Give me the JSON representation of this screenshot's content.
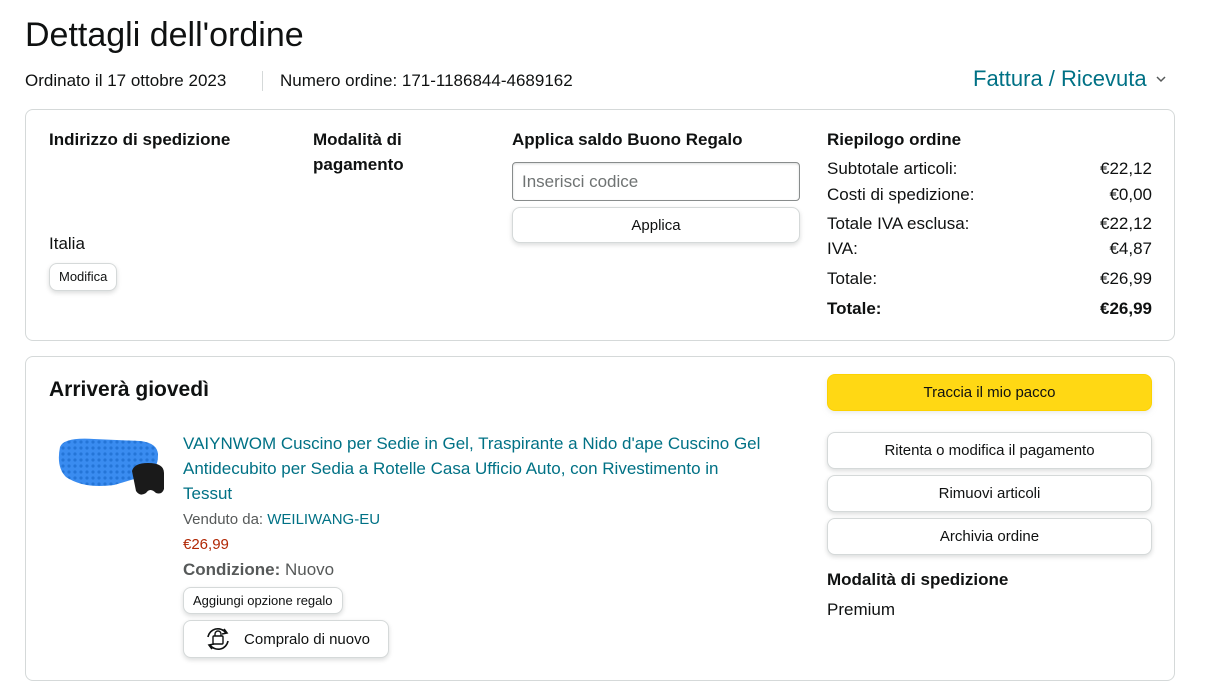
{
  "page": {
    "title": "Dettagli dell'ordine",
    "ordered_on": "Ordinato il 17 ottobre 2023",
    "order_number": "Numero ordine: 171-1186844-4689162",
    "invoice_link": "Fattura / Ricevuta"
  },
  "shipping": {
    "heading": "Indirizzo di spedizione",
    "country": "Italia",
    "edit_button": "Modifica"
  },
  "payment": {
    "heading_line1": "Modalità di",
    "heading_line2": "pagamento"
  },
  "gift_card": {
    "heading": "Applica saldo Buono Regalo",
    "input_placeholder": "Inserisci codice",
    "apply_button": "Applica"
  },
  "summary": {
    "heading": "Riepilogo ordine",
    "rows": [
      {
        "label": "Subtotale articoli:",
        "value": "€22,12"
      },
      {
        "label": "Costi di spedizione:",
        "value": "€0,00"
      },
      {
        "label": "Totale IVA esclusa:",
        "value": "€22,12"
      },
      {
        "label": "IVA:",
        "value": "€4,87"
      },
      {
        "label": "Totale:",
        "value": "€26,99"
      },
      {
        "label": "Totale:",
        "value": "€26,99"
      }
    ]
  },
  "delivery": {
    "heading": "Arriverà giovedì",
    "product": {
      "title_line1": "VAIYNWOM Cuscino per Sedie in Gel, Traspirante a Nido d'ape Cuscino Gel",
      "title_line2": "Antidecubito per Sedia a Rotelle Casa Ufficio Auto, con Rivestimento in",
      "title_line3": "Tessut",
      "sold_by_label": "Venduto da:",
      "seller": "WEILIWANG-EU",
      "price": "€26,99",
      "condition_label": "Condizione:",
      "condition_value": "Nuovo",
      "gift_button": "Aggiungi opzione regalo",
      "buy_again_button": "Compralo di nuovo"
    },
    "actions": {
      "track": "Traccia il mio pacco",
      "retry_payment": "Ritenta o modifica il pagamento",
      "remove_items": "Rimuovi articoli",
      "archive": "Archivia ordine"
    },
    "shipping_method_heading": "Modalità di spedizione",
    "shipping_method_value": "Premium"
  },
  "colors": {
    "link": "#007185",
    "price": "#B12704",
    "primary_button": "#FFD814",
    "border": "#D5D9D9"
  },
  "icons": {
    "invoice_dropdown": "chevron-down-icon",
    "buy_again": "reorder-icon"
  }
}
